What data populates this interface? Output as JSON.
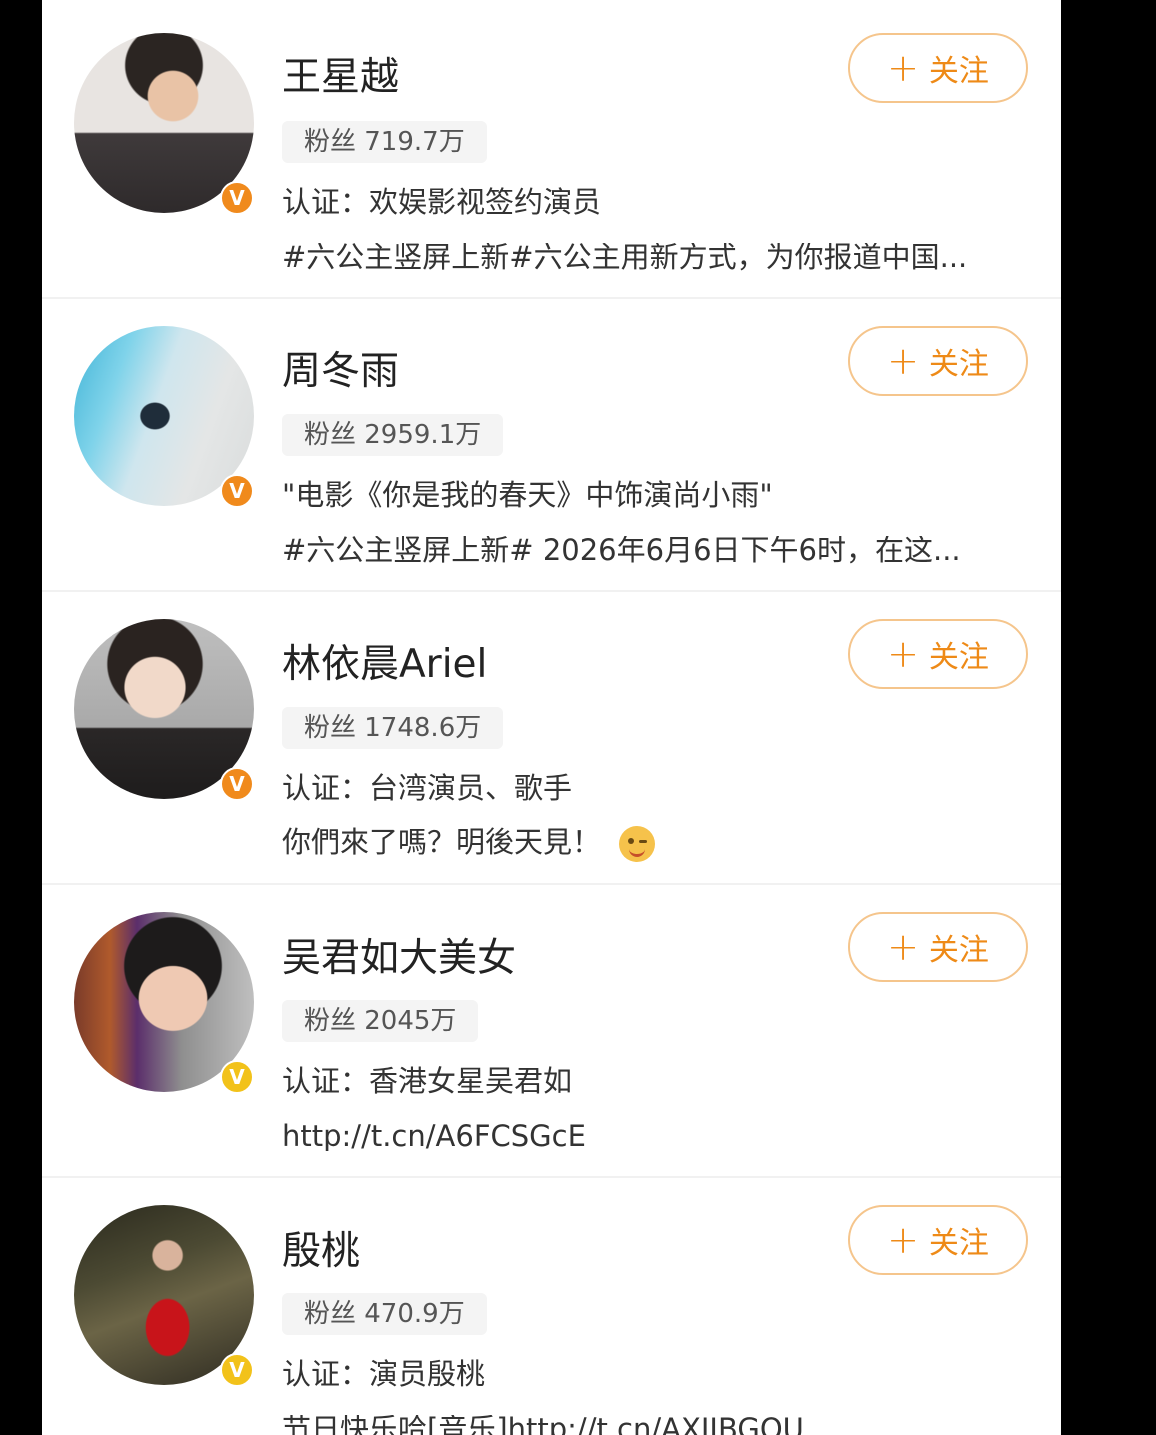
{
  "follow_label": "关注",
  "users": [
    {
      "name": "王星越",
      "fans": "粉丝 719.7万",
      "verify": "认证：欢娱影视签约演员",
      "desc": "#六公主竖屏上新#六公主用新方式，为你报道中国...",
      "badge_color": "#f08a1c",
      "avatar_icon": "avatar-photo"
    },
    {
      "name": "周冬雨",
      "fans": "粉丝 2959.1万",
      "verify": "\"电影《你是我的春天》中饰演尚小雨\"",
      "desc": "#六公主竖屏上新# 2026年6月6日下午6时，在这...",
      "badge_color": "#f08a1c",
      "avatar_icon": "avatar-photo"
    },
    {
      "name": "林依晨Ariel",
      "fans": "粉丝 1748.6万",
      "verify": "认证：台湾演员、歌手",
      "desc": "你們來了嗎？明後天見！",
      "badge_color": "#f08a1c",
      "avatar_icon": "avatar-photo",
      "emoji_icon": "wink-emoji-icon"
    },
    {
      "name": "吴君如大美女",
      "fans": "粉丝 2045万",
      "verify": "认证：香港女星吴君如",
      "desc": "http://t.cn/A6FCSGcE",
      "badge_color": "#f2c21a",
      "avatar_icon": "avatar-photo"
    },
    {
      "name": "殷桃",
      "fans": "粉丝 470.9万",
      "verify": "认证：演员殷桃",
      "desc": "节日快乐哈[音乐]http://t.cn/AXJIBGOU",
      "badge_color": "#f2c21a",
      "avatar_icon": "avatar-photo"
    }
  ]
}
